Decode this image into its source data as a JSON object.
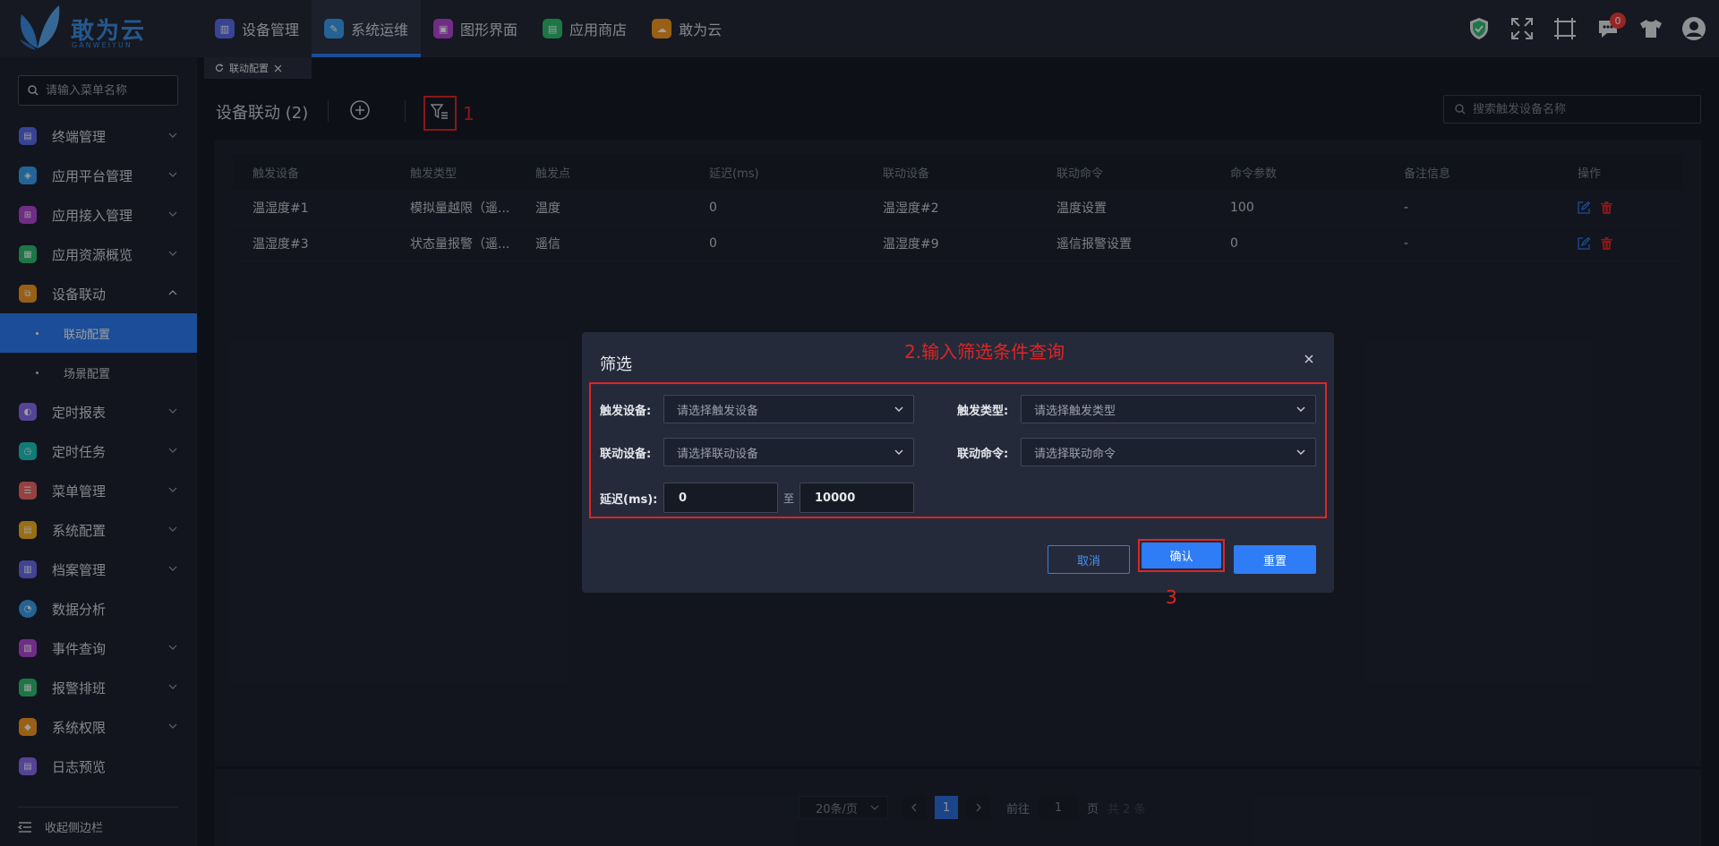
{
  "brand": {
    "name": "敢为云",
    "sub": "GANWEIYUN"
  },
  "topnav": [
    {
      "label": "设备管理",
      "color": "#5b6cf0"
    },
    {
      "label": "系统运维",
      "color": "#3aa0f0",
      "active": true
    },
    {
      "label": "图形界面",
      "color": "#b44ad8"
    },
    {
      "label": "应用商店",
      "color": "#2fbf71"
    },
    {
      "label": "敢为云",
      "color": "#f59a23"
    }
  ],
  "topright": {
    "message_count": "0"
  },
  "sidebar": {
    "search_placeholder": "请输入菜单名称",
    "items": [
      {
        "label": "终端管理",
        "color": "#5b6cf0"
      },
      {
        "label": "应用平台管理",
        "color": "#3aa0f0"
      },
      {
        "label": "应用接入管理",
        "color": "#b44ad8"
      },
      {
        "label": "应用资源概览",
        "color": "#2fbf71"
      },
      {
        "label": "设备联动",
        "color": "#f59a23",
        "expanded": true
      },
      {
        "label": "定时报表",
        "color": "#8a6cf0"
      },
      {
        "label": "定时任务",
        "color": "#1cc7c0"
      },
      {
        "label": "菜单管理",
        "color": "#f06a6a"
      },
      {
        "label": "系统配置",
        "color": "#f5b323"
      },
      {
        "label": "档案管理",
        "color": "#6a6cf0"
      },
      {
        "label": "数据分析",
        "color": "#3aa0f0"
      },
      {
        "label": "事件查询",
        "color": "#b44ad8"
      },
      {
        "label": "报警排班",
        "color": "#2fbf71"
      },
      {
        "label": "系统权限",
        "color": "#f59a23"
      },
      {
        "label": "日志预览",
        "color": "#8a6cf0"
      }
    ],
    "subitems": [
      {
        "label": "联动配置",
        "active": true
      },
      {
        "label": "场景配置"
      }
    ],
    "collapse_label": "收起侧边栏"
  },
  "tab": {
    "label": "联动配置"
  },
  "page": {
    "title": "设备联动 (2)",
    "search_placeholder": "搜索触发设备名称",
    "ann1": "1"
  },
  "table": {
    "headers": [
      "触发设备",
      "触发类型",
      "触发点",
      "延迟(ms)",
      "联动设备",
      "联动命令",
      "命令参数",
      "备注信息",
      "操作"
    ],
    "rows": [
      [
        "温湿度#1",
        "模拟量越限（遥...",
        "温度",
        "0",
        "温湿度#2",
        "温度设置",
        "100",
        "-"
      ],
      [
        "温湿度#3",
        "状态量报警（遥...",
        "遥信",
        "0",
        "温湿度#9",
        "遥信报警设置",
        "0",
        "-"
      ]
    ]
  },
  "pager": {
    "size": "20条/页",
    "current": "1",
    "goto": "前往",
    "goto_value": "1",
    "page_unit": "页",
    "total": "共 2 条"
  },
  "modal": {
    "title": "筛选",
    "ann2": "2.输入筛选条件查询",
    "ann3": "3",
    "trigger_device_label": "触发设备:",
    "trigger_device_ph": "请选择触发设备",
    "trigger_type_label": "触发类型:",
    "trigger_type_ph": "请选择触发类型",
    "link_device_label": "联动设备:",
    "link_device_ph": "请选择联动设备",
    "link_cmd_label": "联动命令:",
    "link_cmd_ph": "请选择联动命令",
    "delay_label": "延迟(ms):",
    "delay_min": "0",
    "delay_to": "至",
    "delay_max": "10000",
    "cancel": "取消",
    "confirm": "确认",
    "reset": "重置"
  }
}
